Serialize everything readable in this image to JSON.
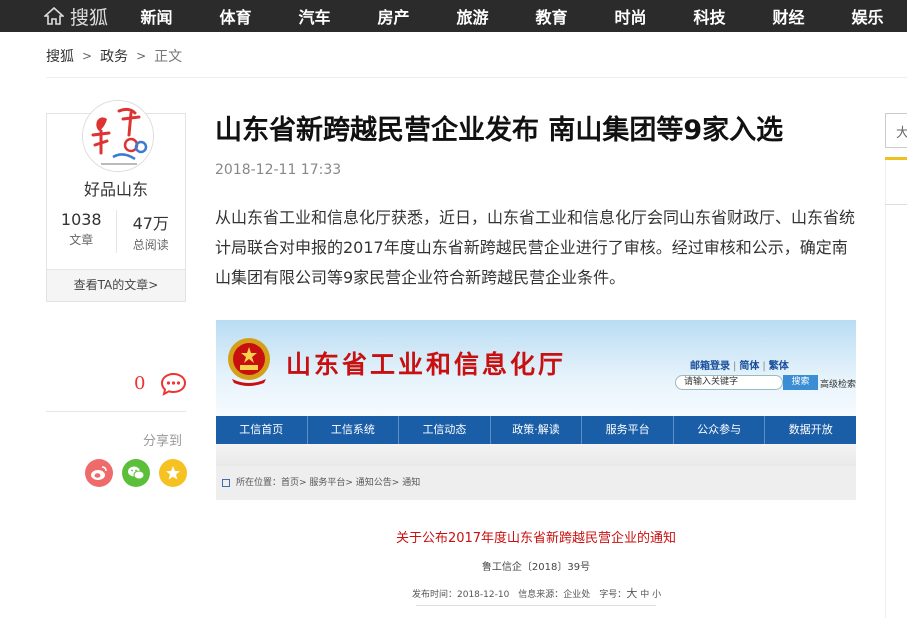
{
  "topbar": {
    "logo": "搜狐",
    "nav": [
      "新闻",
      "体育",
      "汽车",
      "房产",
      "旅游",
      "教育",
      "时尚",
      "科技",
      "财经",
      "娱乐"
    ]
  },
  "breadcrumb": [
    "搜狐",
    "政务",
    "正文"
  ],
  "author": {
    "name": "好品山东",
    "articles_count": "1038",
    "articles_label": "文章",
    "reads_count": "47万",
    "reads_label": "总阅读",
    "view_link": "查看TA的文章>"
  },
  "comments": {
    "count": "0"
  },
  "share": {
    "label": "分享到"
  },
  "article": {
    "title": "山东省新跨越民营企业发布 南山集团等9家入选",
    "timestamp": "2018-12-11 17:33",
    "paragraph": "从山东省工业和信息化厅获悉，近日，山东省工业和信息化厅会同山东省财政厅、山东省统计局联合对申报的2017年度山东省新跨越民营企业进行了审核。经过审核和公示，确定南山集团有限公司等9家民营企业符合新跨越民营企业条件。"
  },
  "embed": {
    "ministry": "山东省工业和信息化厅",
    "links": [
      "邮箱登录",
      "简体",
      "繁体"
    ],
    "search_placeholder": "请输入关键字",
    "search_button": "搜索",
    "advanced_search": "高级检索",
    "nav": [
      "工信首页",
      "工信系统",
      "工信动态",
      "政策·解读",
      "服务平台",
      "公众参与",
      "数据开放"
    ],
    "crumb": "所在位置：首页> 服务平台> 通知公告> 通知",
    "notice_title": "关于公布2017年度山东省新跨越民营企业的通知",
    "doc_number": "鲁工信企〔2018〕39号",
    "meta_prefix": "发布时间：2018-12-10　信息来源：企业处　字号：",
    "font_large": "大",
    "font_medium": "中",
    "font_small": "小"
  },
  "right": {
    "box_char": "大"
  },
  "colors": {
    "topbar": "#2b2b2b",
    "accent_red": "#e33",
    "embed_nav": "#1a5ea8",
    "ministry_red": "#c81010"
  }
}
